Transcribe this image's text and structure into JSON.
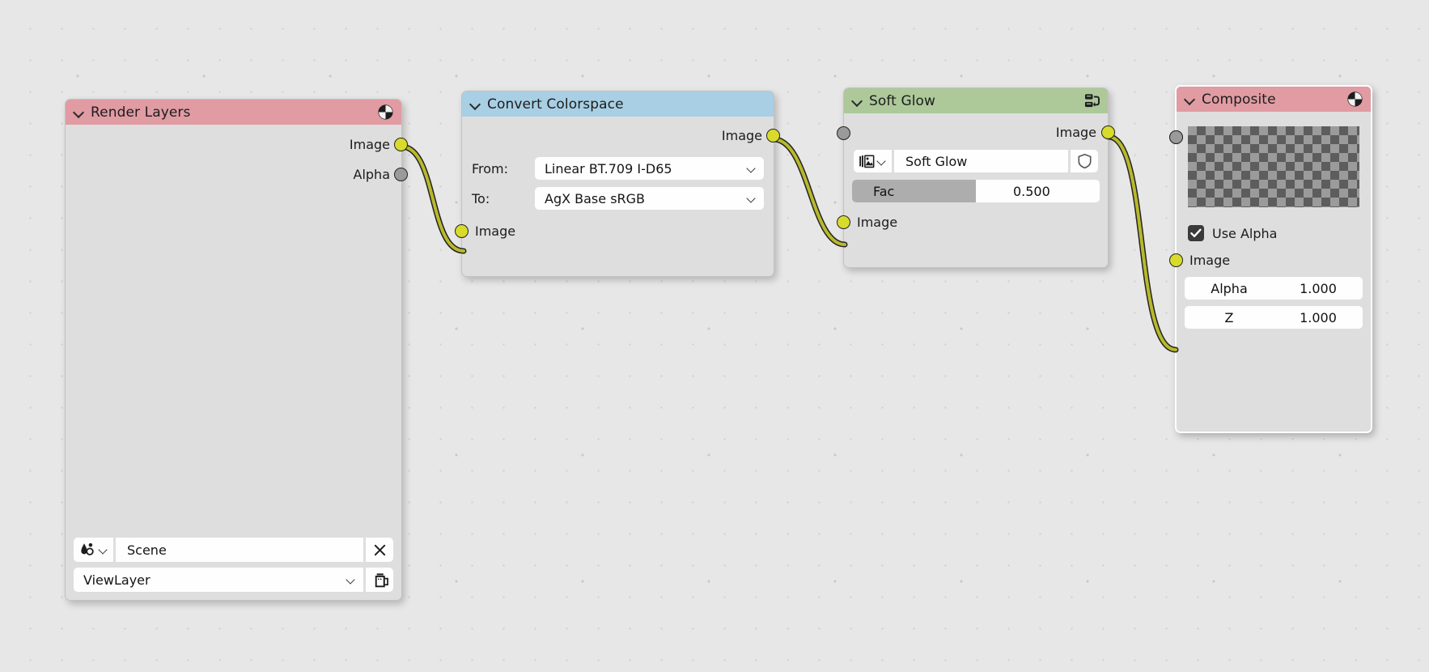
{
  "editor": {
    "name": "Blender Compositor Node Editor",
    "background_color": "#e7e7e7",
    "grid_dot_color": "#c9c9c9"
  },
  "nodes": [
    {
      "id": "render-layers",
      "title": "Render Layers",
      "header_color": "#e09ba3",
      "header_icon": "render-result-icon",
      "outputs": [
        {
          "label": "Image",
          "type": "image",
          "color": "#d9db2c",
          "connected": true
        },
        {
          "label": "Alpha",
          "type": "value",
          "color": "#9a9a9a",
          "connected": false
        }
      ],
      "scene_label": "Scene",
      "scene_icon": "scene-data-icon",
      "scene_clear_icon": "close-x-icon",
      "view_layer_label": "ViewLayer",
      "view_layer_icon": "render-layers-icon"
    },
    {
      "id": "convert-colorspace",
      "title": "Convert Colorspace",
      "header_color": "#a8cfe4",
      "outputs": [
        {
          "label": "Image",
          "type": "image",
          "color": "#d9db2c",
          "connected": true
        }
      ],
      "from_label": "From:",
      "from_value": "Linear BT.709 I-D65",
      "to_label": "To:",
      "to_value": "AgX Base sRGB",
      "inputs": [
        {
          "label": "Image",
          "type": "image",
          "color": "#d9db2c",
          "connected": true
        }
      ]
    },
    {
      "id": "soft-glow",
      "title": "Soft Glow",
      "header_color": "#adc99a",
      "header_icon": "node-group-icon",
      "outputs": [
        {
          "label": "Image",
          "type": "image",
          "color": "#d9db2c",
          "connected": true
        }
      ],
      "datablock_icon": "image-datablock-icon",
      "datablock_name": "Soft Glow",
      "shield_icon": "fake-user-shield-icon",
      "fac_label": "Fac",
      "fac_value": "0.500",
      "fac_percent": 50,
      "inputs": [
        {
          "label": "Image",
          "type": "image",
          "color": "#d9db2c",
          "connected": true
        }
      ]
    },
    {
      "id": "composite",
      "title": "Composite",
      "header_color": "#e09ba3",
      "header_icon": "render-result-icon",
      "selected": true,
      "preview": "transparent-checkerboard",
      "use_alpha_label": "Use Alpha",
      "use_alpha_checked": true,
      "check_icon": "checkmark-icon",
      "inputs": [
        {
          "label": "Image",
          "type": "image",
          "color": "#d9db2c",
          "connected": true
        }
      ],
      "alpha_label": "Alpha",
      "alpha_value": "1.000",
      "z_label": "Z",
      "z_value": "1.000"
    }
  ],
  "links": [
    {
      "from": "render-layers.Image",
      "to": "convert-colorspace.Image",
      "color": "#b8b92c"
    },
    {
      "from": "convert-colorspace.Image",
      "to": "soft-glow.Image",
      "color": "#b8b92c"
    },
    {
      "from": "soft-glow.Image",
      "to": "composite.Image",
      "color": "#b8b92c"
    }
  ]
}
